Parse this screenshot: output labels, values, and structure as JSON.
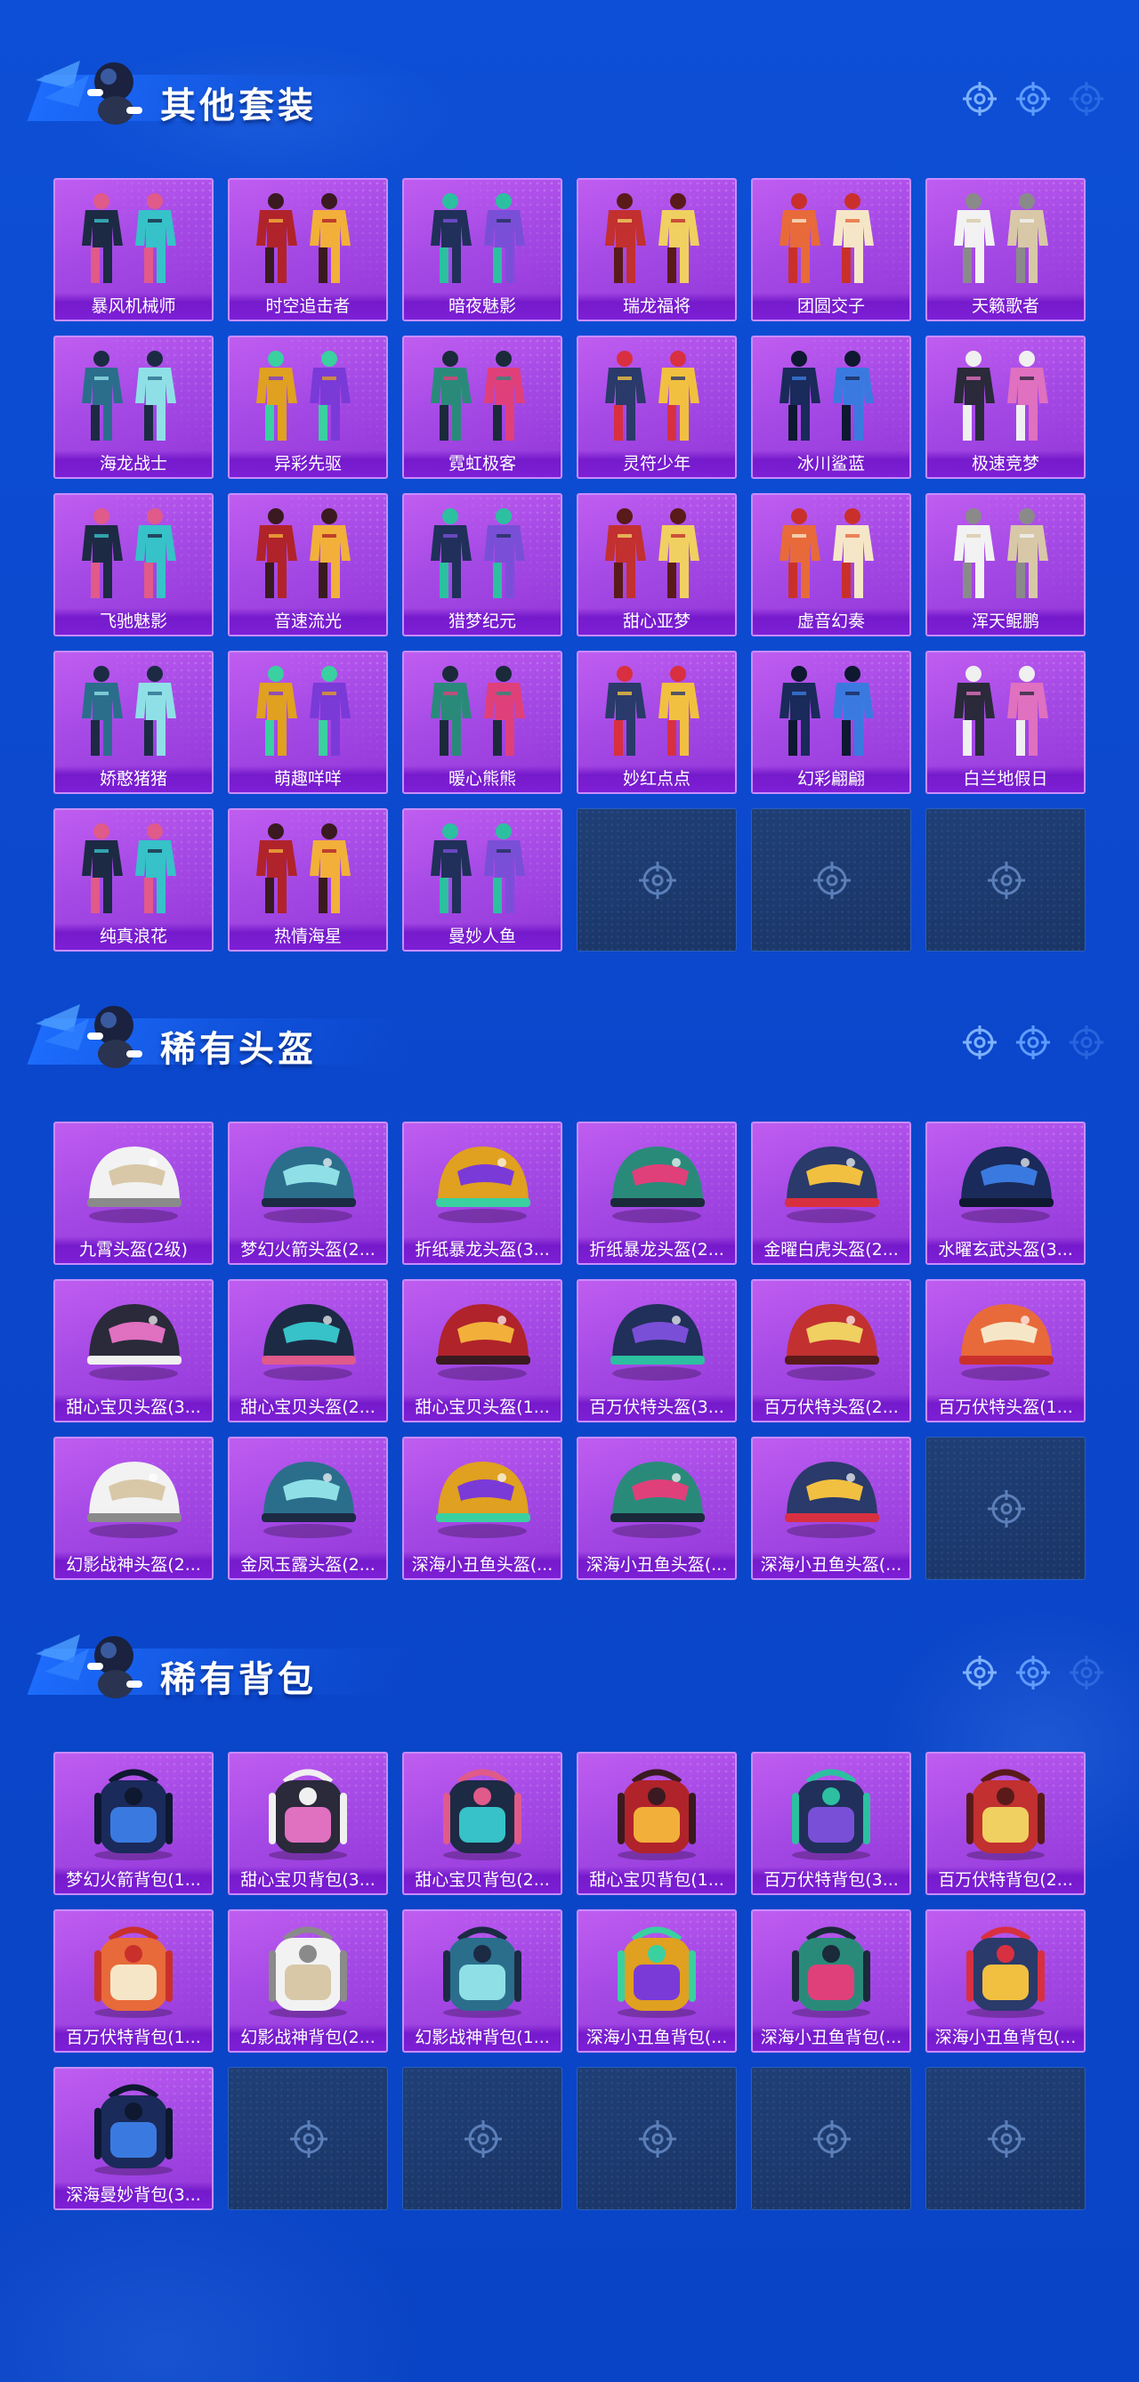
{
  "colors": {
    "background": "#0b47cc",
    "card_fill": "#a64ae6",
    "card_border": "#c98cff",
    "label_fill": "#7e1fd6",
    "empty_slot": "#1c3a6d"
  },
  "sections": [
    {
      "title": "其他套装",
      "kind": "outfit",
      "items": [
        "暴风机械师",
        "时空追击者",
        "暗夜魅影",
        "瑞龙福将",
        "团圆交子",
        "天籁歌者",
        "海龙战士",
        "异彩先驱",
        "霓虹极客",
        "灵符少年",
        "冰川鲨蓝",
        "极速竞梦",
        "飞驰魅影",
        "音速流光",
        "猎梦纪元",
        "甜心亚梦",
        "虚音幻奏",
        "浑天鲲鹏",
        "娇憨猪猪",
        "萌趣咩咩",
        "暖心熊熊",
        "妙红点点",
        "幻彩翩翩",
        "白兰地假日",
        "纯真浪花",
        "热情海星",
        "曼妙人鱼"
      ],
      "empty_slots": 3
    },
    {
      "title": "稀有头盔",
      "kind": "helmet",
      "items": [
        "九霄头盔(2级)",
        "梦幻火箭头盔(2...",
        "折纸暴龙头盔(3...",
        "折纸暴龙头盔(2...",
        "金曜白虎头盔(2...",
        "水曜玄武头盔(3...",
        "甜心宝贝头盔(3...",
        "甜心宝贝头盔(2...",
        "甜心宝贝头盔(1...",
        "百万伏特头盔(3...",
        "百万伏特头盔(2...",
        "百万伏特头盔(1...",
        "幻影战神头盔(2...",
        "金凤玉露头盔(2...",
        "深海小丑鱼头盔(...",
        "深海小丑鱼头盔(...",
        "深海小丑鱼头盔(..."
      ],
      "empty_slots": 1
    },
    {
      "title": "稀有背包",
      "kind": "backpack",
      "items": [
        "梦幻火箭背包(1...",
        "甜心宝贝背包(3...",
        "甜心宝贝背包(2...",
        "甜心宝贝背包(1...",
        "百万伏特背包(3...",
        "百万伏特背包(2...",
        "百万伏特背包(1...",
        "幻影战神背包(2...",
        "幻影战神背包(1...",
        "深海小丑鱼背包(...",
        "深海小丑鱼背包(...",
        "深海小丑鱼背包(...",
        "深海曼妙背包(3..."
      ],
      "empty_slots": 5
    }
  ]
}
